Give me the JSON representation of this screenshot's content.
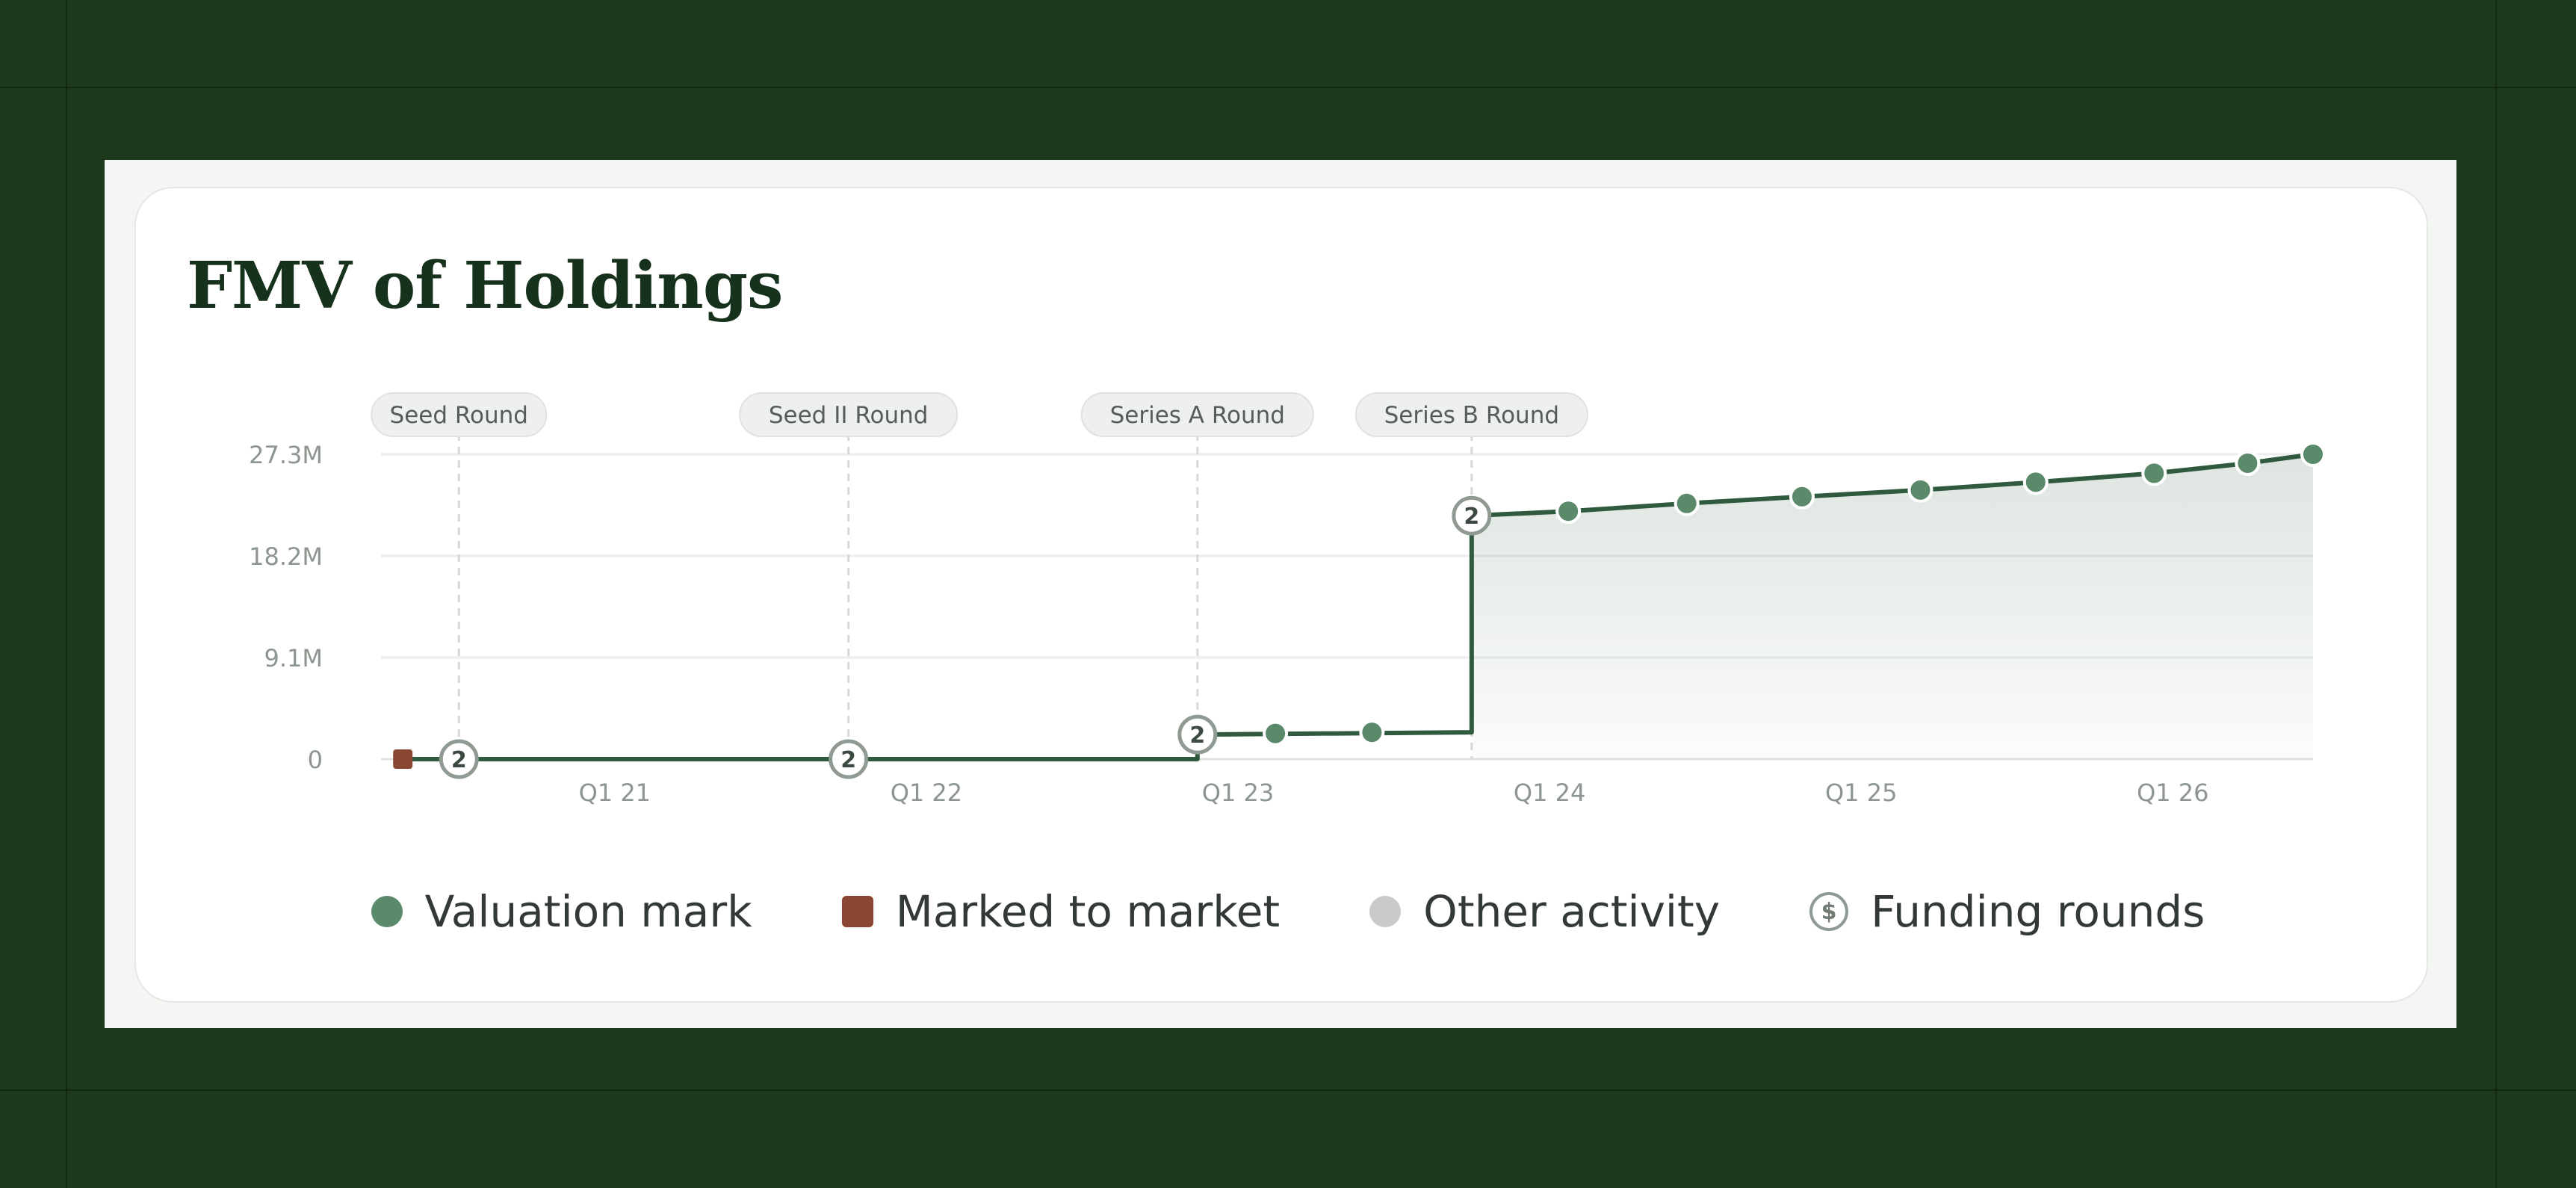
{
  "title": "FMV of Holdings",
  "colors": {
    "line": "#2f5a3e",
    "valuation_mark": "#5b8a6b",
    "marked_to_market": "#8b4533",
    "other_activity": "#c8cbc8",
    "funding_ring": "#8e9a92"
  },
  "legend": {
    "valuation_mark": "Valuation mark",
    "marked_to_market": "Marked to market",
    "other_activity": "Other activity",
    "funding_rounds": "Funding rounds",
    "funding_icon_glyph": "$"
  },
  "chart_data": {
    "type": "line",
    "title": "FMV of Holdings",
    "x_ticks": [
      "Q1 21",
      "Q1 22",
      "Q1 23",
      "Q1 24",
      "Q1 25",
      "Q1 26"
    ],
    "x_tick_values": [
      2021.0,
      2022.0,
      2023.0,
      2024.0,
      2025.0,
      2026.0
    ],
    "xlim": [
      2020.25,
      2026.45
    ],
    "y_ticks": [
      "0",
      "9.1M",
      "18.2M",
      "27.3M"
    ],
    "y_tick_values": [
      0,
      9.1,
      18.2,
      27.3
    ],
    "ylim": [
      0,
      27.3
    ],
    "y_unit": "M",
    "grid": true,
    "legend_position": "bottom",
    "funding_rounds": [
      {
        "label": "Seed Round",
        "x": 2020.5,
        "y": 0,
        "count": "2"
      },
      {
        "label": "Seed II Round",
        "x": 2021.75,
        "y": 0,
        "count": "2"
      },
      {
        "label": "Series A Round",
        "x": 2022.87,
        "y": 2.2,
        "count": "2"
      },
      {
        "label": "Series B Round",
        "x": 2023.75,
        "y": 21.8,
        "count": "2"
      }
    ],
    "marked_to_market": [
      {
        "x": 2020.32,
        "y": 0
      }
    ],
    "valuation_marks": [
      {
        "x": 2023.12,
        "y": 2.3
      },
      {
        "x": 2023.43,
        "y": 2.4
      },
      {
        "x": 2024.06,
        "y": 22.2
      },
      {
        "x": 2024.44,
        "y": 22.9
      },
      {
        "x": 2024.81,
        "y": 23.5
      },
      {
        "x": 2025.19,
        "y": 24.1
      },
      {
        "x": 2025.56,
        "y": 24.8
      },
      {
        "x": 2025.94,
        "y": 25.6
      },
      {
        "x": 2026.24,
        "y": 26.5
      },
      {
        "x": 2026.45,
        "y": 27.3
      }
    ],
    "series": [
      {
        "points": [
          {
            "x": 2020.32,
            "y": 0
          },
          {
            "x": 2022.87,
            "y": 0
          },
          {
            "x": 2022.87,
            "y": 2.2
          },
          {
            "x": 2023.75,
            "y": 2.4
          },
          {
            "x": 2023.75,
            "y": 21.8
          },
          {
            "x": 2024.06,
            "y": 22.2
          },
          {
            "x": 2024.44,
            "y": 22.9
          },
          {
            "x": 2024.81,
            "y": 23.5
          },
          {
            "x": 2025.19,
            "y": 24.1
          },
          {
            "x": 2025.56,
            "y": 24.8
          },
          {
            "x": 2025.94,
            "y": 25.6
          },
          {
            "x": 2026.24,
            "y": 26.5
          },
          {
            "x": 2026.45,
            "y": 27.3
          }
        ]
      }
    ]
  }
}
